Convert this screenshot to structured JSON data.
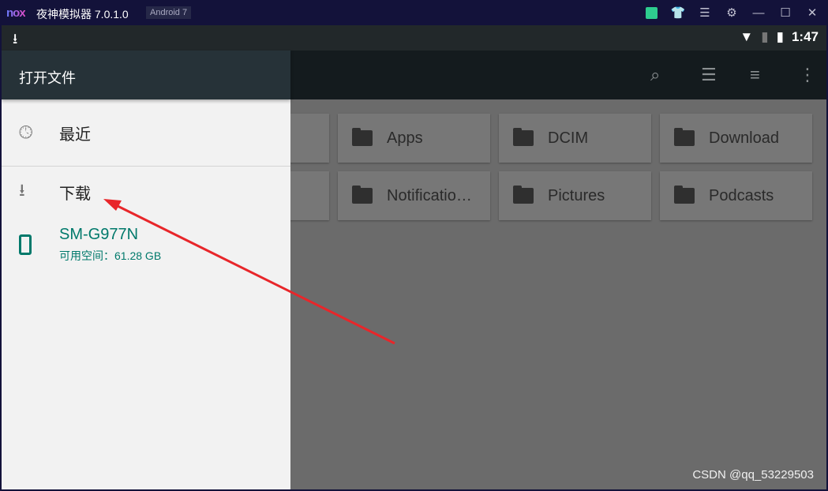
{
  "window": {
    "logo": "nox",
    "title": "夜神模拟器 7.0.1.0",
    "android_badge": "Android 7",
    "icons": [
      "shop-icon",
      "skin-icon",
      "menu-icon",
      "settings-icon",
      "minimize-icon",
      "maximize-icon",
      "close-icon"
    ]
  },
  "statusbar": {
    "time": "1:47"
  },
  "drawer": {
    "title": "打开文件",
    "items": [
      {
        "label": "最近",
        "icon": "clock-icon"
      },
      {
        "label": "下载",
        "icon": "download-icon"
      }
    ],
    "device": {
      "name": "SM-G977N",
      "free": "可用空间：61.28 GB"
    }
  },
  "folders": [
    "Apps",
    "DCIM",
    "Download",
    "Notificatio…",
    "Pictures",
    "Podcasts"
  ],
  "annotation": {
    "arrow_color": "#e8262a"
  },
  "watermark": "CSDN @qq_53229503"
}
